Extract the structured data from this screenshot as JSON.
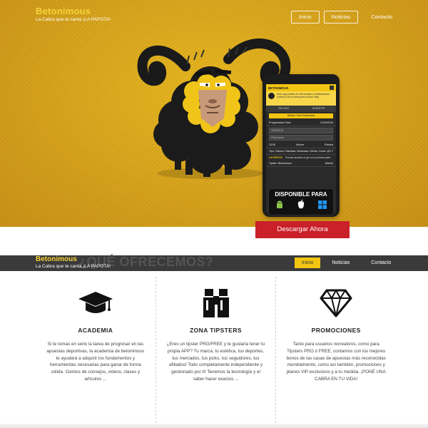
{
  "brand": {
    "title": "Betonimous",
    "subtitle": "La Cabra que te canta ¡LA PAPOTA!"
  },
  "nav": {
    "inicio": "Inicio",
    "noticias": "Noticias",
    "contacto": "Contacto"
  },
  "phone": {
    "app_title": "BETONIMOUS",
    "notice": "Hola, aqui podrás ver mis consejos y clasificaciones... ¡Sabía! (Crea tu cabra para conocer más)",
    "tabs": [
      "EN VIVO",
      "EVENTOS"
    ],
    "show_button": "Mostrar Todo Destacados",
    "programmed_label": "Programados Para:",
    "programmed_date": "21/09/2016",
    "date_input": "23/09/2016",
    "filter_placeholder": "Filtrar items",
    "match_time": "13:00",
    "match_home": "Unione",
    "match_away": "Polonia",
    "tip_label": "Tipo: Clásica",
    "tip_text": "Dificultad: Moderada / Media",
    "odds": "Cuota: @1.7",
    "papota_label": "LA PAPOTA",
    "papota_text": "Polonia anotará un gol en la primera parte",
    "tipster_label": "Tipster: Betonimous",
    "tipster_status": "Abierto"
  },
  "badge": {
    "title": "DISPONIBLE PARA"
  },
  "download_button": "Descargar Ahora",
  "ghost_heading": "¿QUÉ OFRECEMOS?",
  "features": [
    {
      "icon": "graduation-cap-icon",
      "title": "ACADEMIA",
      "text": "Si te tomas en serio la tarea de progresar en las apuestas deportivas, la academia de betonimous te ayudará a adquirir los fundamentos y herramientas necesarias para ganar de forma sólida. Cientos de consejos, videos, clases y artículos ..."
    },
    {
      "icon": "binoculars-icon",
      "title": "ZONA TIPSTERS",
      "text": "¿Eres un tipster PRO/FREE y te gustaria tener tu propia APP? Tu marca, tu estética, tus deportes, tus mercados, tus picks, tus seguidores, tus afiliados! Todo completamente independiente y gestionado por tí! Tenemos la tecnología y el saber hacer exactos ..."
    },
    {
      "icon": "diamond-icon",
      "title": "PROMOCIONES",
      "text": "Tanto para usuarios recreativos, como para Tipsters PRO ó FREE, contamos con los mejores bonos de las casas de apuestas más reconocidas mundialmente, como así también, promociones y planes VIP exclusivos y a tu medida. ¡PONÉ UNA CABRA EN TU VIDA!"
    }
  ]
}
